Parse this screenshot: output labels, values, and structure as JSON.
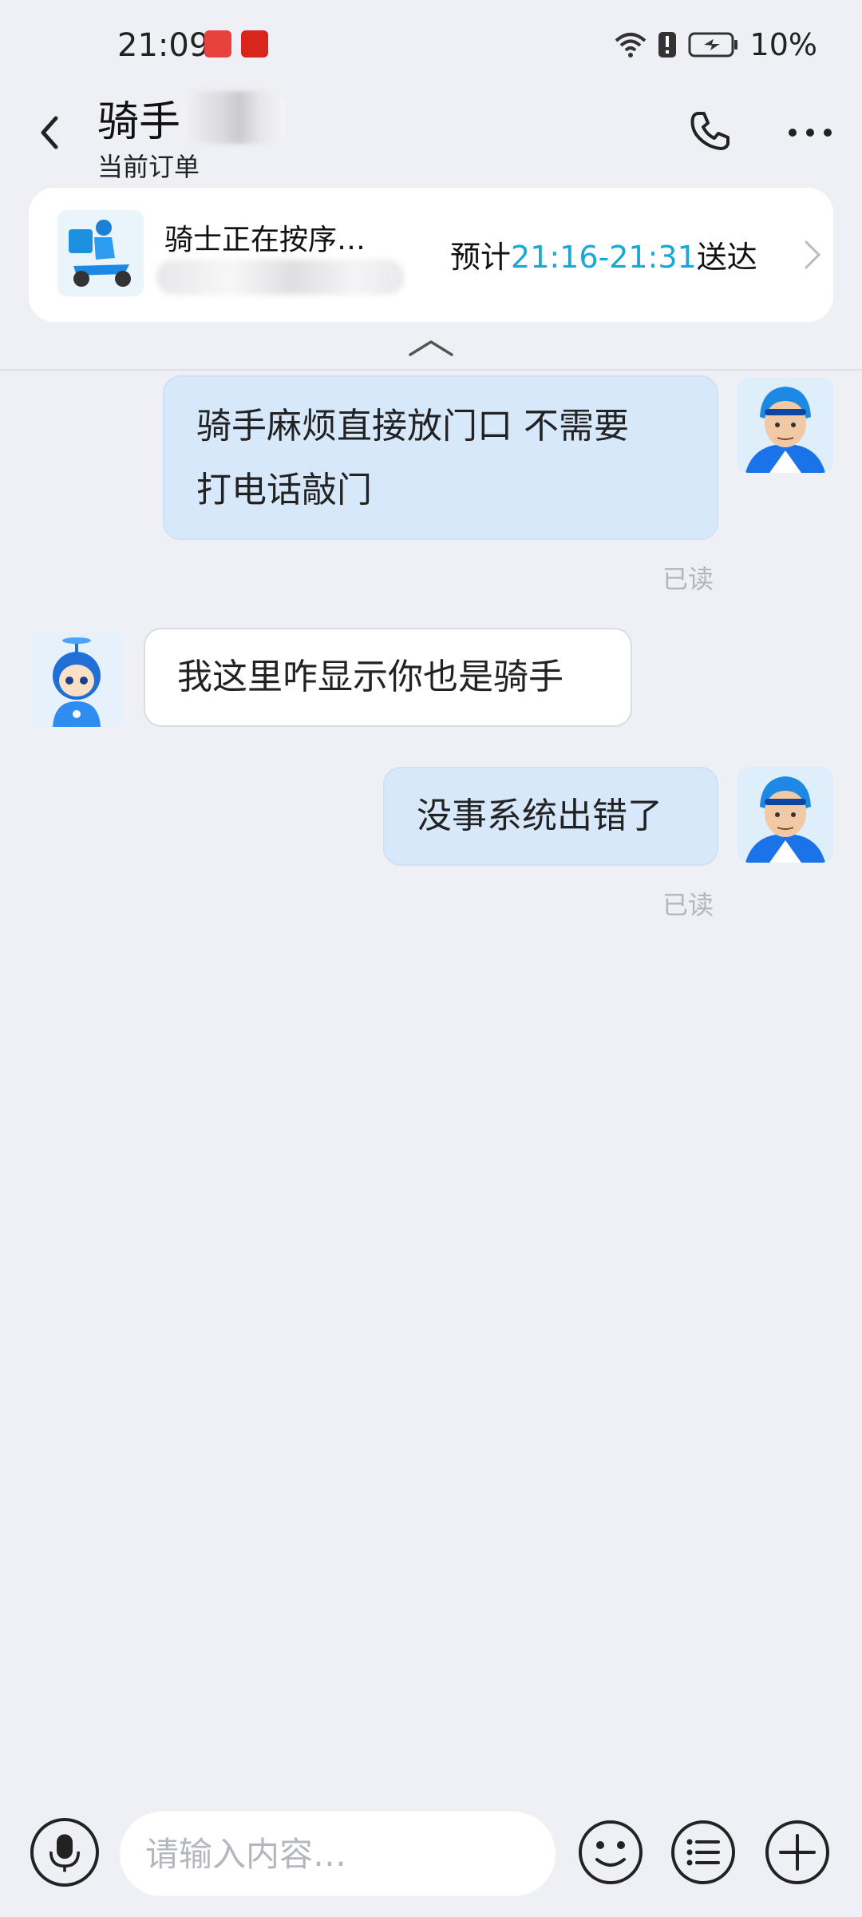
{
  "status_bar": {
    "time": "21:09",
    "battery_percent": "10%",
    "icons": [
      "notification-app-icon",
      "taobao-app-icon",
      "wifi-icon",
      "alert-icon",
      "battery-charging-icon"
    ]
  },
  "header": {
    "title": "骑手",
    "subtitle": "当前订单",
    "icons": [
      "back-arrow-icon",
      "phone-icon",
      "more-dots-icon"
    ]
  },
  "order_card": {
    "title": "骑士正在按序…",
    "eta_prefix": "预计",
    "eta_time": "21:16-21:31",
    "eta_suffix": "送达",
    "accent_color": "#1aa7d6"
  },
  "messages": [
    {
      "sender": "me",
      "text_line1": "骑手麻烦直接放门口 不需要",
      "text_line2": "打电话敲门",
      "status": "已读"
    },
    {
      "sender": "other",
      "text": "我这里咋显示你也是骑手"
    },
    {
      "sender": "me",
      "text": "没事系统出错了",
      "status": "已读"
    }
  ],
  "input_bar": {
    "placeholder": "请输入内容…",
    "icons": [
      "microphone-icon",
      "emoji-icon",
      "list-menu-icon",
      "plus-icon"
    ]
  },
  "colors": {
    "background": "#eef0f5",
    "my_bubble": "#d8e8fb",
    "their_bubble": "#ffffff",
    "read_label": "#b3b6bc"
  }
}
